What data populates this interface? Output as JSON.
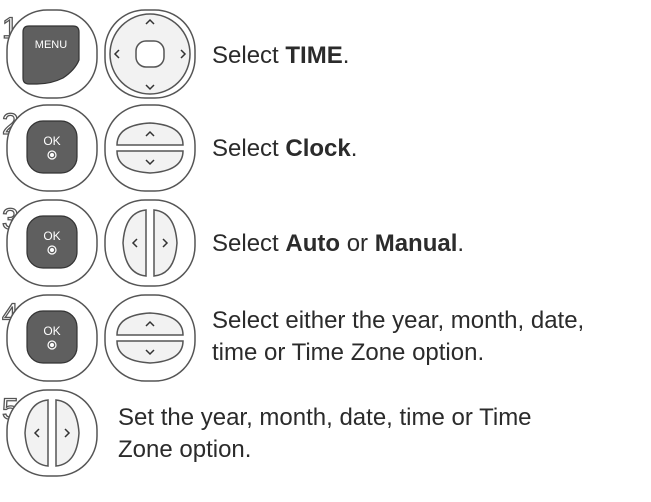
{
  "steps": [
    {
      "number": "1",
      "buttons": [
        "menu-button-icon",
        "four-way-nav-pad-icon"
      ],
      "menu_label": "MENU",
      "text_pre": "Select ",
      "text_bold": "TIME",
      "text_post": "."
    },
    {
      "number": "2",
      "buttons": [
        "ok-button-icon",
        "up-down-buttons-icon"
      ],
      "ok_label": "OK",
      "text_pre": "Select ",
      "text_bold": "Clock",
      "text_post": "."
    },
    {
      "number": "3",
      "buttons": [
        "ok-button-icon",
        "left-right-buttons-icon"
      ],
      "ok_label": "OK",
      "text_pre": "Select ",
      "text_bold": "Auto",
      "text_mid": " or ",
      "text_bold2": "Manual",
      "text_post": "."
    },
    {
      "number": "4",
      "buttons": [
        "ok-button-icon",
        "up-down-buttons-icon"
      ],
      "ok_label": "OK",
      "line1": "Select either the year, month, date,",
      "line2": "time or Time Zone option."
    },
    {
      "number": "5",
      "buttons": [
        "left-right-buttons-icon"
      ],
      "line1": "Set the year, month, date, time or Time",
      "line2": "Zone option."
    }
  ],
  "colors": {
    "key_dark": "#5f5f5f",
    "key_light": "#f4f4f4",
    "outline": "#555555",
    "text": "#2b2b2b"
  }
}
